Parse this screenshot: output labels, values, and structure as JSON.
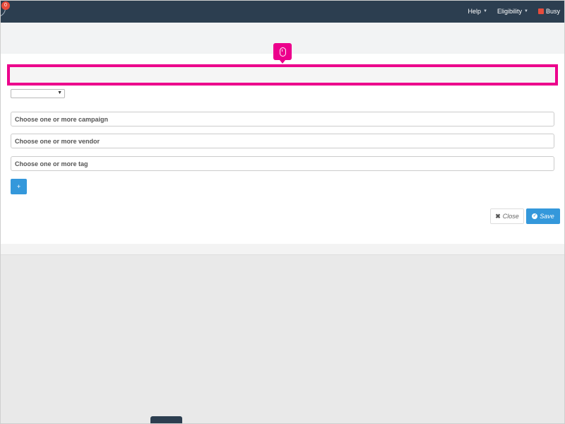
{
  "navbar": {
    "notification_count": "0",
    "help_label": "Help",
    "eligibility_label": "Eligibility",
    "status_label": "Busy",
    "status_color": "#e74c3c"
  },
  "form": {
    "campaign_placeholder": "Choose one or more campaign",
    "vendor_placeholder": "Choose one or more vendor",
    "tag_placeholder": "Choose one or more tag",
    "add_label": "+",
    "close_label": "Close",
    "save_label": "Save"
  },
  "colors": {
    "navbar": "#2c3e50",
    "accent": "#3498db",
    "highlight": "#ec008c"
  },
  "icons": {
    "marker": "mouse-icon",
    "close": "x-icon",
    "save": "check-circle-icon"
  }
}
